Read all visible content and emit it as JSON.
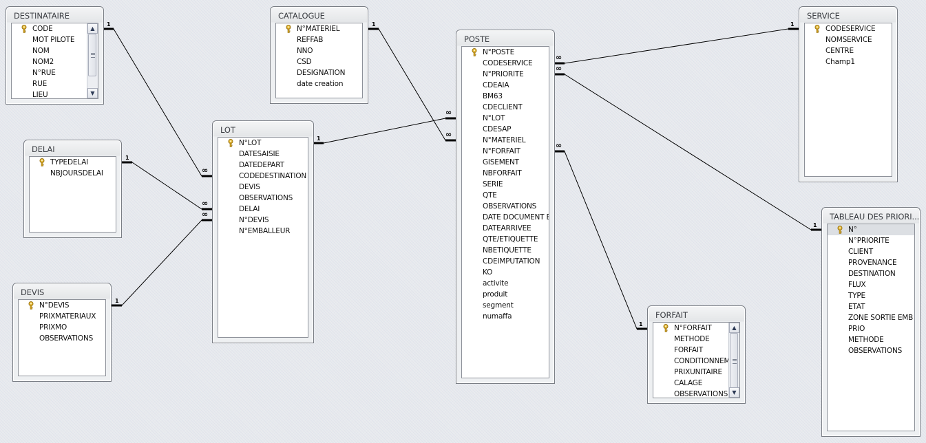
{
  "tables": {
    "destinataire": {
      "title": "DESTINATAIRE",
      "fields": [
        "CODE",
        "MOT PILOTE",
        "NOM",
        "NOM2",
        "N°RUE",
        "RUE",
        "LIEU"
      ],
      "primary_key": "CODE",
      "has_scrollbar": true
    },
    "catalogue": {
      "title": "CATALOGUE",
      "fields": [
        "N°MATERIEL",
        "REFFAB",
        "NNO",
        "CSD",
        "DESIGNATION",
        "date creation"
      ],
      "primary_key": "N°MATERIEL"
    },
    "poste": {
      "title": "POSTE",
      "fields": [
        "N°POSTE",
        "CODESERVICE",
        "N°PRIORITE",
        "CDEAIA",
        "BM63",
        "CDECLIENT",
        "N°LOT",
        "CDESAP",
        "N°MATERIEL",
        "N°FORFAIT",
        "GISEMENT",
        "NBFORFAIT",
        "SERIE",
        "QTE",
        "OBSERVATIONS",
        "DATE DOCUMENT E",
        "DATEARRIVEE",
        "QTE/ETIQUETTE",
        "NBETIQUETTE",
        "CDEIMPUTATION",
        "KO",
        "activite",
        "produit",
        "segment",
        "numaffa"
      ],
      "primary_key": "N°POSTE"
    },
    "service": {
      "title": "SERVICE",
      "fields": [
        "CODESERVICE",
        "NOMSERVICE",
        "CENTRE",
        "Champ1"
      ],
      "primary_key": "CODESERVICE"
    },
    "delai": {
      "title": "DELAI",
      "fields": [
        "TYPEDELAI",
        "NBJOURSDELAI"
      ],
      "primary_key": "TYPEDELAI"
    },
    "lot": {
      "title": "LOT",
      "fields": [
        "N°LOT",
        "DATESAISIE",
        "DATEDEPART",
        "CODEDESTINATION",
        "DEVIS",
        "OBSERVATIONS",
        "DELAI",
        "N°DEVIS",
        "N°EMBALLEUR"
      ],
      "primary_key": "N°LOT"
    },
    "devis": {
      "title": "DEVIS",
      "fields": [
        "N°DEVIS",
        "PRIXMATERIAUX",
        "PRIXMO",
        "OBSERVATIONS"
      ],
      "primary_key": "N°DEVIS"
    },
    "forfait": {
      "title": "FORFAIT",
      "fields": [
        "N°FORFAIT",
        "METHODE",
        "FORFAIT",
        "CONDITIONNEM",
        "PRIXUNITAIRE",
        "CALAGE",
        "OBSERVATIONS"
      ],
      "primary_key": "N°FORFAIT",
      "has_scrollbar": true
    },
    "tableau_priorites": {
      "title": "TABLEAU DES PRIORI...",
      "fields": [
        "N°",
        "N°PRIORITE",
        "CLIENT",
        "PROVENANCE",
        "DESTINATION",
        "FLUX",
        "TYPE",
        "ETAT",
        "ZONE  SORTIE EMB",
        "PRIO",
        "METHODE",
        "OBSERVATIONS"
      ],
      "primary_key": "N°",
      "selected_field": "N°"
    }
  },
  "relationships": [
    {
      "from": "DESTINATAIRE",
      "from_field": "CODE",
      "from_card": "1",
      "to": "LOT",
      "to_field": "CODEDESTINATION",
      "to_card": "∞"
    },
    {
      "from": "DELAI",
      "from_field": "TYPEDELAI",
      "from_card": "1",
      "to": "LOT",
      "to_field": "DELAI",
      "to_card": "∞"
    },
    {
      "from": "DEVIS",
      "from_field": "N°DEVIS",
      "from_card": "1",
      "to": "LOT",
      "to_field": "N°DEVIS",
      "to_card": "∞"
    },
    {
      "from": "LOT",
      "from_field": "N°LOT",
      "from_card": "1",
      "to": "POSTE",
      "to_field": "N°LOT",
      "to_card": "∞"
    },
    {
      "from": "CATALOGUE",
      "from_field": "N°MATERIEL",
      "from_card": "1",
      "to": "POSTE",
      "to_field": "N°MATERIEL",
      "to_card": "∞"
    },
    {
      "from": "SERVICE",
      "from_field": "CODESERVICE",
      "from_card": "1",
      "to": "POSTE",
      "to_field": "CODESERVICE",
      "to_card": "∞"
    },
    {
      "from": "TABLEAU DES PRIORITES",
      "from_field": "N°",
      "from_card": "1",
      "to": "POSTE",
      "to_field": "N°PRIORITE",
      "to_card": "∞"
    },
    {
      "from": "FORFAIT",
      "from_field": "N°FORFAIT",
      "from_card": "1",
      "to": "POSTE",
      "to_field": "N°FORFAIT",
      "to_card": "∞"
    }
  ],
  "icons": {
    "primary_key": "key-icon",
    "scroll_up": "▲",
    "scroll_down": "▼"
  },
  "colors": {
    "background": "#e9ecef",
    "list_bg": "#ffffff",
    "selected_row": "#dcdfe3",
    "key_icon": "#d6a520",
    "relationship_line": "#000000"
  }
}
